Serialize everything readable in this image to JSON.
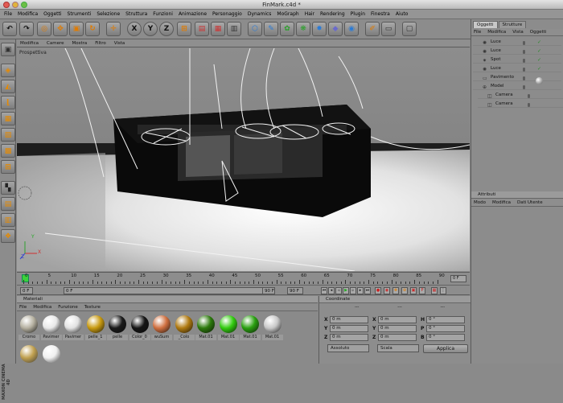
{
  "window": {
    "title": "FinMark.c4d *"
  },
  "menubar": [
    "File",
    "Modifica",
    "Oggetti",
    "Strumenti",
    "Selezione",
    "Struttura",
    "Funzioni",
    "Animazione",
    "Personaggio",
    "Dynamics",
    "MoGraph",
    "Hair",
    "Rendering",
    "Plugin",
    "Finestra",
    "Aiuto"
  ],
  "toolbar": {
    "axis_x": "X",
    "axis_y": "Y",
    "axis_z": "Z"
  },
  "viewport": {
    "menu": [
      "Modifica",
      "Camere",
      "Mostra",
      "Filtro",
      "Vista"
    ],
    "label": "Prospettiva",
    "axes": {
      "x": "X",
      "y": "Y",
      "z": "Z"
    }
  },
  "timeline": {
    "ticks": [
      "0",
      "5",
      "10",
      "15",
      "20",
      "25",
      "30",
      "35",
      "40",
      "45",
      "50",
      "55",
      "60",
      "65",
      "70",
      "75",
      "80",
      "85",
      "90"
    ],
    "end_marker": "0 F"
  },
  "transport": {
    "start_field": "0 F",
    "current_field": "0 F",
    "end_field": "90 F",
    "max_field": "90 F"
  },
  "materials": {
    "title": "Materiali",
    "menu": [
      "File",
      "Modifica",
      "Funzione",
      "Texture"
    ],
    "items": [
      {
        "label": "Cromo",
        "color": "#b5b0a0"
      },
      {
        "label": "Pavimer",
        "color": "#e8e8e8"
      },
      {
        "label": "Pavimer",
        "color": "#e2e2e2"
      },
      {
        "label": "pelle_1",
        "color": "#c89a10"
      },
      {
        "label": "pelle",
        "color": "#1a1a1a"
      },
      {
        "label": "Color_0",
        "color": "#151515"
      },
      {
        "label": "wuSum",
        "color": "#d07040"
      },
      {
        "label": "_Colo",
        "color": "#b07a10"
      },
      {
        "label": "Mat.01",
        "color": "#2c7a0c"
      },
      {
        "label": "Mat.01",
        "color": "#33cc10"
      },
      {
        "label": "Mat.01",
        "color": "#2aa010"
      },
      {
        "label": "Mat.01",
        "color": "#c8c8c8"
      }
    ],
    "extra": [
      {
        "color": "#c0a050"
      },
      {
        "color": "#f0f0f0"
      }
    ]
  },
  "coordinates": {
    "title": "Coordinate",
    "col_headers": [
      "---",
      "---",
      "---"
    ],
    "rows": [
      {
        "axis": "X",
        "pos": "0 m",
        "size": "0 m",
        "axis2": "H",
        "rot": "0 °"
      },
      {
        "axis": "Y",
        "pos": "0 m",
        "size": "0 m",
        "axis2": "P",
        "rot": "0 °"
      },
      {
        "axis": "Z",
        "pos": "0 m",
        "size": "0 m",
        "axis2": "B",
        "rot": "0 °"
      }
    ],
    "mode": "Assoluto",
    "scale": "Scala",
    "apply": "Applica"
  },
  "objects": {
    "tabs": [
      "Oggetti",
      "Strutture"
    ],
    "menu": [
      "File",
      "Modifica",
      "Vista",
      "Oggetti"
    ],
    "items": [
      {
        "name": "Luce",
        "icon": "light-icon"
      },
      {
        "name": "Luce",
        "icon": "light-icon"
      },
      {
        "name": "Spot",
        "icon": "spotlight-icon"
      },
      {
        "name": "Luce",
        "icon": "light-icon"
      },
      {
        "name": "Pavimento",
        "icon": "floor-icon"
      },
      {
        "name": "Model",
        "icon": "null-icon"
      },
      {
        "name": "Camera",
        "icon": "camera-icon"
      },
      {
        "name": "Camera",
        "icon": "camera-icon"
      }
    ]
  },
  "attributes": {
    "title": "Attributi",
    "menu": [
      "Modo",
      "Modifica",
      "Dati Utente"
    ]
  }
}
